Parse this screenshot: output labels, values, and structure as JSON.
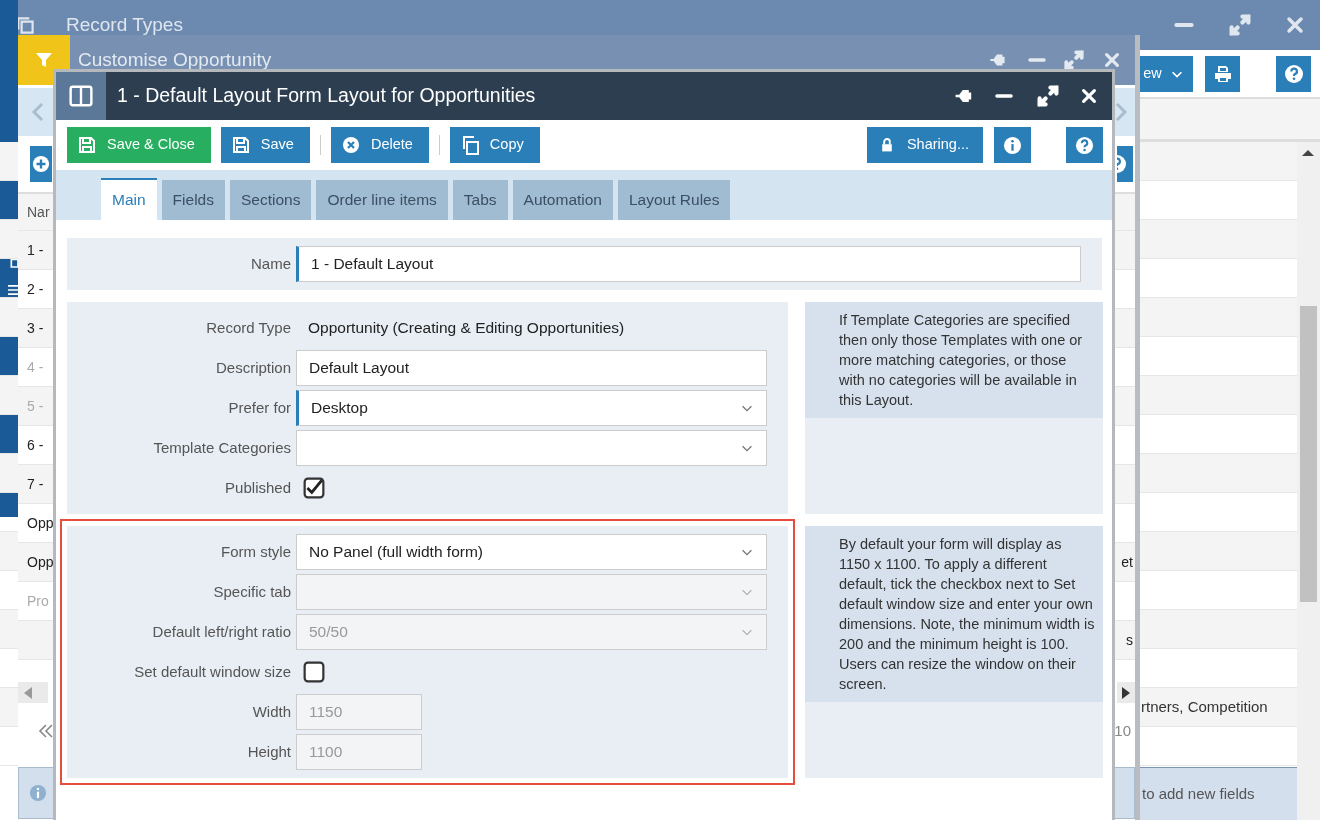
{
  "record_types_window": {
    "title": "Record Types",
    "view_button": "ew",
    "rows": [
      {
        "text": "rtners, Competition"
      }
    ],
    "hint": "to add new fields"
  },
  "customise_window": {
    "title": "Customise Opportunity",
    "column_header": "Nar",
    "rows": [
      {
        "text": "1 -",
        "disabled": false
      },
      {
        "text": "2 -",
        "disabled": false
      },
      {
        "text": "3 -",
        "disabled": false
      },
      {
        "text": "4 -",
        "disabled": true
      },
      {
        "text": "5 -",
        "disabled": true
      },
      {
        "text": "6 -",
        "disabled": false
      },
      {
        "text": "7 -",
        "disabled": false
      },
      {
        "text": "Opp",
        "disabled": false
      },
      {
        "text": "Opp",
        "end_text": "et",
        "disabled": false
      },
      {
        "text": "Pro",
        "disabled": true
      },
      {
        "end_text": "s",
        "disabled": false
      }
    ],
    "pager_count": "10"
  },
  "layout_dialog": {
    "title": "1 - Default Layout Form Layout for Opportunities",
    "toolbar": [
      {
        "kind": "save-close",
        "label": "Save & Close"
      },
      {
        "kind": "save",
        "label": "Save"
      },
      {
        "kind": "delete",
        "label": "Delete"
      },
      {
        "kind": "copy",
        "label": "Copy"
      }
    ],
    "toolbar_right": [
      {
        "kind": "sharing",
        "label": "Sharing..."
      },
      {
        "kind": "info"
      },
      {
        "kind": "help"
      }
    ],
    "tabs": [
      {
        "label": "Main",
        "selected": true
      },
      {
        "label": "Fields",
        "selected": false
      },
      {
        "label": "Sections",
        "selected": false
      },
      {
        "label": "Order line items",
        "selected": false
      },
      {
        "label": "Tabs",
        "selected": false
      },
      {
        "label": "Automation",
        "selected": false
      },
      {
        "label": "Layout Rules",
        "selected": false
      }
    ],
    "name_field": {
      "label": "Name",
      "value": "1 - Default Layout",
      "required": true
    },
    "sections": [
      {
        "highlighted": false,
        "info": "If Template Categories are specified then only those Templates with one or more matching categories, or those with no categories will be available in this Layout.",
        "fields": [
          {
            "kind": "text",
            "label": "Record Type",
            "value": "Opportunity (Creating & Editing Opportunities)"
          },
          {
            "kind": "input",
            "label": "Description",
            "value": "Default Layout",
            "disabled": false
          },
          {
            "kind": "select",
            "label": "Prefer for",
            "value": "Desktop",
            "required": true,
            "disabled": false
          },
          {
            "kind": "select",
            "label": "Template Categories",
            "disabled": false
          },
          {
            "kind": "checkbox",
            "label": "Published",
            "checked": true
          }
        ]
      },
      {
        "highlighted": true,
        "info": "By default your form will display as 1150 x 1100. To apply a different default, tick the checkbox next to Set default window size and enter your own dimensions. Note, the minimum width is 200 and the minimum height is 100. Users can resize the window on their screen.",
        "fields": [
          {
            "kind": "select",
            "label": "Form style",
            "value": "No Panel (full width form)",
            "disabled": false
          },
          {
            "kind": "select",
            "label": "Specific tab",
            "disabled": true
          },
          {
            "kind": "select",
            "label": "Default left/right ratio",
            "value": "50/50",
            "disabled": true
          },
          {
            "kind": "checkbox",
            "label": "Set default window size",
            "checked": false
          },
          {
            "kind": "short-input",
            "label": "Width",
            "value": "1150",
            "disabled": true
          },
          {
            "kind": "short-input",
            "label": "Height",
            "value": "1100",
            "disabled": true
          }
        ]
      }
    ]
  }
}
